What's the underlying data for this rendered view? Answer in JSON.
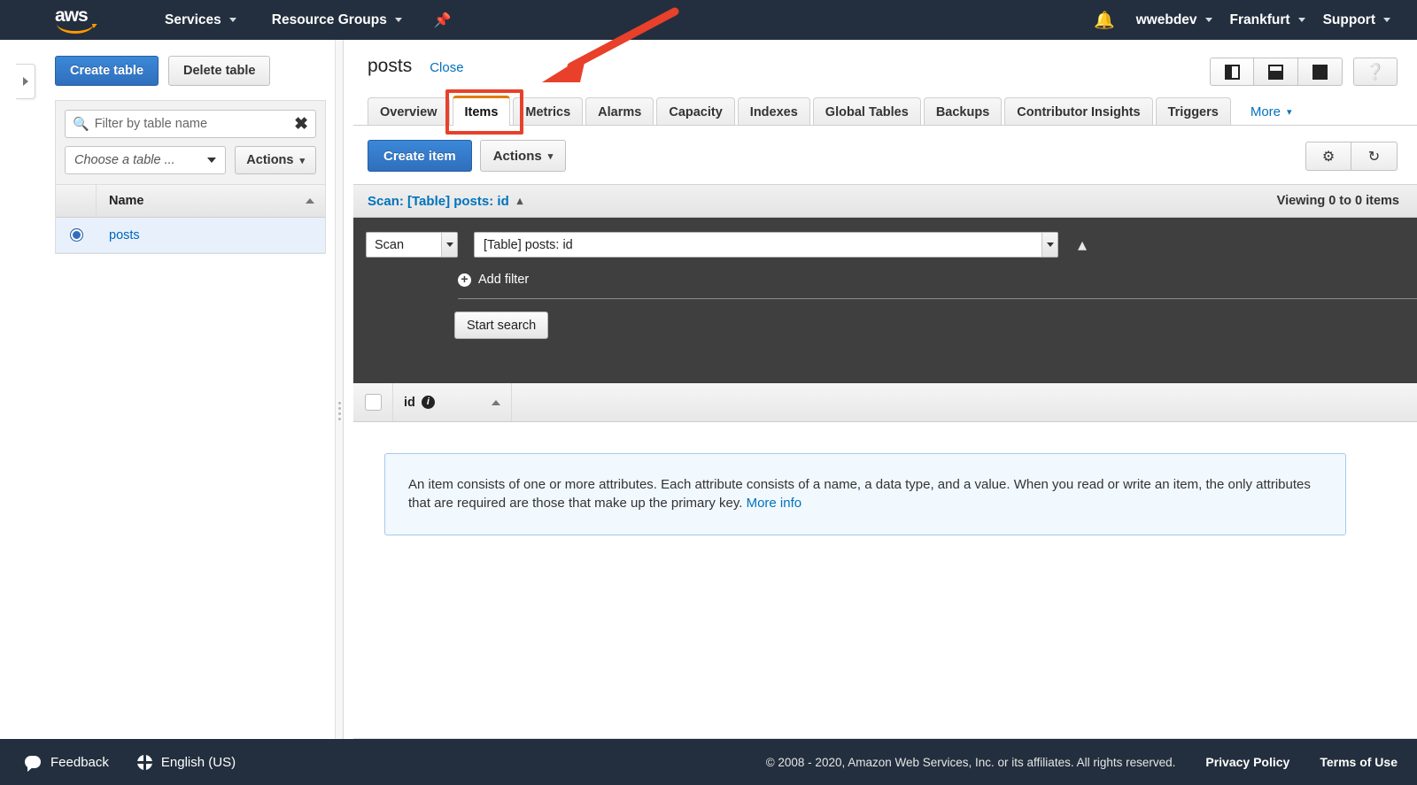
{
  "topnav": {
    "logo_alt": "aws",
    "services": "Services",
    "resource_groups": "Resource Groups",
    "pin_icon": "pin-icon",
    "bell_icon": "bell-icon",
    "account": "wwebdev",
    "region": "Frankfurt",
    "support": "Support"
  },
  "sidebar": {
    "create_table": "Create table",
    "delete_table": "Delete table",
    "filter_placeholder": "Filter by table name",
    "filter_value": "",
    "choose_table": "Choose a table ...",
    "actions": "Actions",
    "column_name": "Name",
    "rows": [
      {
        "name": "posts",
        "selected": true
      }
    ]
  },
  "main": {
    "table_title": "posts",
    "close_link": "Close",
    "view_buttons": [
      "split-vertical-view",
      "split-horizontal-view",
      "full-view"
    ],
    "help_label": "?",
    "tabs": [
      {
        "label": "Overview",
        "active": false
      },
      {
        "label": "Items",
        "active": true
      },
      {
        "label": "Metrics",
        "active": false
      },
      {
        "label": "Alarms",
        "active": false
      },
      {
        "label": "Capacity",
        "active": false
      },
      {
        "label": "Indexes",
        "active": false
      },
      {
        "label": "Global Tables",
        "active": false
      },
      {
        "label": "Backups",
        "active": false
      },
      {
        "label": "Contributor Insights",
        "active": false
      },
      {
        "label": "Triggers",
        "active": false
      }
    ],
    "more_tab": "More",
    "toolbar": {
      "create_item": "Create item",
      "actions": "Actions",
      "settings_icon": "gear-icon",
      "refresh_icon": "refresh-icon"
    },
    "scanbar": {
      "label": "Scan: [Table] posts: id",
      "viewing": "Viewing 0 to 0 items"
    },
    "scanpanel": {
      "operation": "Scan",
      "target": "[Table] posts: id",
      "add_filter": "Add filter",
      "start_search": "Start search"
    },
    "items_table": {
      "columns": [
        {
          "label": "id",
          "has_info": true,
          "sorted": "asc"
        }
      ],
      "rows": []
    },
    "alert": {
      "text": "An item consists of one or more attributes. Each attribute consists of a name, a data type, and a value. When you read or write an item, the only attributes that are required are those that make up the primary key.",
      "link": "More info"
    }
  },
  "annotation": {
    "color": "#e8402a",
    "target": "Items tab"
  },
  "footer": {
    "feedback": "Feedback",
    "language": "English (US)",
    "copyright": "© 2008 - 2020, Amazon Web Services, Inc. or its affiliates. All rights reserved.",
    "privacy": "Privacy Policy",
    "terms": "Terms of Use"
  },
  "colors": {
    "nav_bg": "#232f3e",
    "accent_orange": "#ff9900",
    "primary_blue": "#2f6fbd",
    "link_blue": "#0073bb",
    "dark_panel": "#3f3f3f",
    "annotation_red": "#e8402a"
  }
}
